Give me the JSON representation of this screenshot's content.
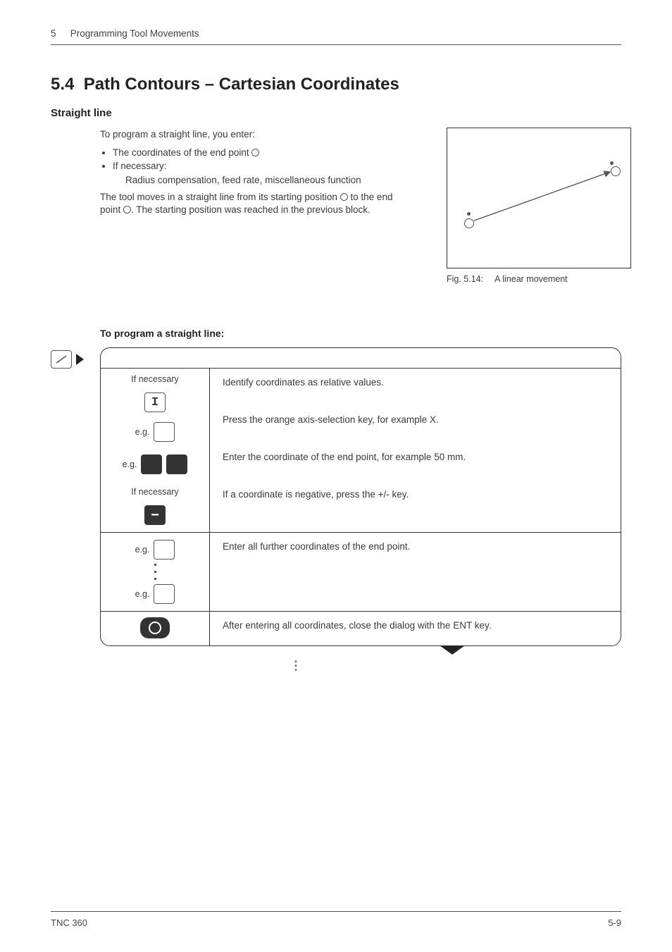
{
  "header": {
    "chapter_number": "5",
    "chapter_title": "Programming Tool Movements"
  },
  "section": {
    "number": "5.4",
    "title": "Path Contours – Cartesian Coordinates"
  },
  "subheading": "Straight line",
  "intro": {
    "lead": "To program a straight line, you enter:",
    "bullet1": "The coordinates of the end point ",
    "bullet2_line1": "If necessary:",
    "bullet2_line2": "Radius compensation, feed rate, miscellaneous function",
    "movement1": "The tool moves in a straight line from its starting position ",
    "movement1_b": " to the end",
    "movement2": "point ",
    "movement2_b": ". The starting position was reached in the previous block."
  },
  "figure": {
    "caption_label": "Fig. 5.14:",
    "caption_text": "A linear movement"
  },
  "program_heading": "To program a straight line:",
  "steps": {
    "s1": {
      "label": "If necessary",
      "key": "I",
      "desc": "Identify coordinates as relative values."
    },
    "s2": {
      "label": "e.g.",
      "desc": "Press the orange axis-selection key, for example X."
    },
    "s3": {
      "label": "e.g.",
      "desc": "Enter the coordinate of the end point, for example 50 mm."
    },
    "s4": {
      "label": "If necessary",
      "desc": "If a coordinate is negative, press the +/- key."
    },
    "s5": {
      "label_a": "e.g.",
      "label_b": "e.g.",
      "desc": "Enter all further coordinates of the end point."
    },
    "s6": {
      "desc": "After entering all coordinates, close the dialog with the ENT key."
    }
  },
  "footer": {
    "left": "TNC 360",
    "right": "5-9"
  }
}
